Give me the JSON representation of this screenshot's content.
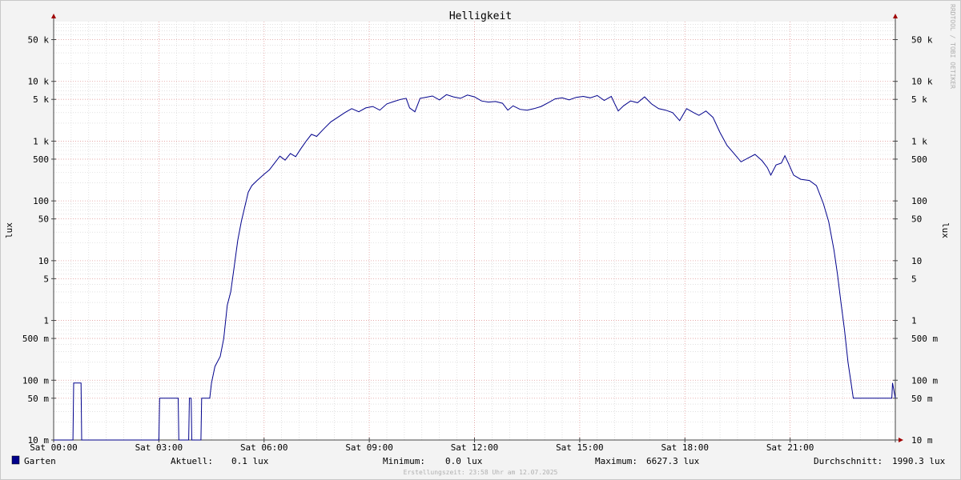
{
  "chart_data": {
    "type": "line",
    "title": "Helligkeit",
    "ylabel": "lux",
    "y_scale": "log",
    "ylim": [
      0.01,
      100000
    ],
    "xlim_hours": [
      0,
      24
    ],
    "grid": true,
    "x_ticks": [
      {
        "label": "Sat 00:00",
        "hour": 0
      },
      {
        "label": "Sat 03:00",
        "hour": 3
      },
      {
        "label": "Sat 06:00",
        "hour": 6
      },
      {
        "label": "Sat 09:00",
        "hour": 9
      },
      {
        "label": "Sat 12:00",
        "hour": 12
      },
      {
        "label": "Sat 15:00",
        "hour": 15
      },
      {
        "label": "Sat 18:00",
        "hour": 18
      },
      {
        "label": "Sat 21:00",
        "hour": 21
      }
    ],
    "y_ticks": [
      {
        "label": "10 m",
        "value": 0.01
      },
      {
        "label": "50 m",
        "value": 0.05
      },
      {
        "label": "100 m",
        "value": 0.1
      },
      {
        "label": "500 m",
        "value": 0.5
      },
      {
        "label": "1",
        "value": 1
      },
      {
        "label": "5",
        "value": 5
      },
      {
        "label": "10",
        "value": 10
      },
      {
        "label": "50",
        "value": 50
      },
      {
        "label": "100",
        "value": 100
      },
      {
        "label": "500",
        "value": 500
      },
      {
        "label": "1 k",
        "value": 1000
      },
      {
        "label": "5 k",
        "value": 5000
      },
      {
        "label": "10 k",
        "value": 10000
      },
      {
        "label": "50 k",
        "value": 50000
      }
    ],
    "series": [
      {
        "name": "Garten",
        "color": "#00008b",
        "points": [
          [
            0.0,
            0.01
          ],
          [
            0.55,
            0.01
          ],
          [
            0.57,
            0.09
          ],
          [
            0.78,
            0.09
          ],
          [
            0.8,
            0.01
          ],
          [
            3.0,
            0.01
          ],
          [
            3.02,
            0.05
          ],
          [
            3.55,
            0.05
          ],
          [
            3.57,
            0.01
          ],
          [
            3.85,
            0.01
          ],
          [
            3.87,
            0.05
          ],
          [
            3.92,
            0.05
          ],
          [
            3.94,
            0.01
          ],
          [
            4.2,
            0.01
          ],
          [
            4.22,
            0.05
          ],
          [
            4.45,
            0.05
          ],
          [
            4.5,
            0.09
          ],
          [
            4.6,
            0.17
          ],
          [
            4.75,
            0.25
          ],
          [
            4.85,
            0.5
          ],
          [
            4.95,
            1.8
          ],
          [
            5.05,
            3.0
          ],
          [
            5.15,
            8
          ],
          [
            5.25,
            22
          ],
          [
            5.35,
            45
          ],
          [
            5.45,
            80
          ],
          [
            5.55,
            140
          ],
          [
            5.65,
            180
          ],
          [
            5.8,
            220
          ],
          [
            6.0,
            280
          ],
          [
            6.15,
            330
          ],
          [
            6.3,
            430
          ],
          [
            6.45,
            560
          ],
          [
            6.6,
            480
          ],
          [
            6.75,
            620
          ],
          [
            6.9,
            550
          ],
          [
            7.05,
            750
          ],
          [
            7.2,
            1000
          ],
          [
            7.35,
            1300
          ],
          [
            7.5,
            1200
          ],
          [
            7.7,
            1600
          ],
          [
            7.9,
            2100
          ],
          [
            8.1,
            2500
          ],
          [
            8.3,
            3000
          ],
          [
            8.5,
            3500
          ],
          [
            8.7,
            3100
          ],
          [
            8.9,
            3600
          ],
          [
            9.1,
            3800
          ],
          [
            9.3,
            3300
          ],
          [
            9.5,
            4200
          ],
          [
            9.7,
            4600
          ],
          [
            9.9,
            5000
          ],
          [
            10.05,
            5200
          ],
          [
            10.15,
            3600
          ],
          [
            10.3,
            3100
          ],
          [
            10.45,
            5200
          ],
          [
            10.6,
            5400
          ],
          [
            10.8,
            5700
          ],
          [
            11.0,
            4900
          ],
          [
            11.2,
            6000
          ],
          [
            11.4,
            5500
          ],
          [
            11.6,
            5200
          ],
          [
            11.8,
            5900
          ],
          [
            12.0,
            5500
          ],
          [
            12.2,
            4700
          ],
          [
            12.4,
            4500
          ],
          [
            12.6,
            4600
          ],
          [
            12.8,
            4300
          ],
          [
            12.95,
            3300
          ],
          [
            13.1,
            3900
          ],
          [
            13.3,
            3400
          ],
          [
            13.5,
            3300
          ],
          [
            13.7,
            3500
          ],
          [
            13.9,
            3800
          ],
          [
            14.1,
            4400
          ],
          [
            14.3,
            5100
          ],
          [
            14.5,
            5300
          ],
          [
            14.7,
            4900
          ],
          [
            14.9,
            5400
          ],
          [
            15.1,
            5600
          ],
          [
            15.3,
            5300
          ],
          [
            15.5,
            5800
          ],
          [
            15.7,
            4800
          ],
          [
            15.9,
            5600
          ],
          [
            16.0,
            4200
          ],
          [
            16.1,
            3200
          ],
          [
            16.25,
            3900
          ],
          [
            16.45,
            4700
          ],
          [
            16.65,
            4400
          ],
          [
            16.85,
            5500
          ],
          [
            17.05,
            4200
          ],
          [
            17.25,
            3500
          ],
          [
            17.45,
            3300
          ],
          [
            17.65,
            3000
          ],
          [
            17.85,
            2200
          ],
          [
            18.05,
            3500
          ],
          [
            18.25,
            3000
          ],
          [
            18.4,
            2700
          ],
          [
            18.6,
            3200
          ],
          [
            18.8,
            2500
          ],
          [
            19.0,
            1400
          ],
          [
            19.2,
            850
          ],
          [
            19.4,
            620
          ],
          [
            19.6,
            450
          ],
          [
            19.8,
            520
          ],
          [
            20.0,
            600
          ],
          [
            20.2,
            470
          ],
          [
            20.35,
            360
          ],
          [
            20.45,
            270
          ],
          [
            20.6,
            400
          ],
          [
            20.75,
            430
          ],
          [
            20.85,
            570
          ],
          [
            20.95,
            430
          ],
          [
            21.1,
            270
          ],
          [
            21.3,
            230
          ],
          [
            21.55,
            220
          ],
          [
            21.75,
            180
          ],
          [
            21.95,
            90
          ],
          [
            22.1,
            45
          ],
          [
            22.25,
            15
          ],
          [
            22.35,
            6
          ],
          [
            22.45,
            2
          ],
          [
            22.55,
            0.7
          ],
          [
            22.65,
            0.2
          ],
          [
            22.75,
            0.08
          ],
          [
            22.8,
            0.05
          ],
          [
            23.9,
            0.05
          ],
          [
            23.92,
            0.09
          ],
          [
            24.0,
            0.05
          ]
        ]
      }
    ]
  },
  "legend": {
    "series_name": "Garten",
    "aktuell_label": "Aktuell:",
    "aktuell_value": "0.1 lux",
    "minimum_label": "Minimum:",
    "minimum_value": "0.0 lux",
    "maximum_label": "Maximum:",
    "maximum_value": "6627.3 lux",
    "durchschnitt_label": "Durchschnitt:",
    "durchschnitt_value": "1990.3 lux"
  },
  "footer": "Erstellungszeit: 23:58 Uhr am 12.07.2025",
  "watermark": "RRDTOOL / TOBI OETIKER",
  "colors": {
    "line": "#00008b",
    "major_grid": "#e6a0a0",
    "minor_grid": "#cfcfcf",
    "background": "#f3f3f3",
    "plot_background": "#ffffff"
  }
}
